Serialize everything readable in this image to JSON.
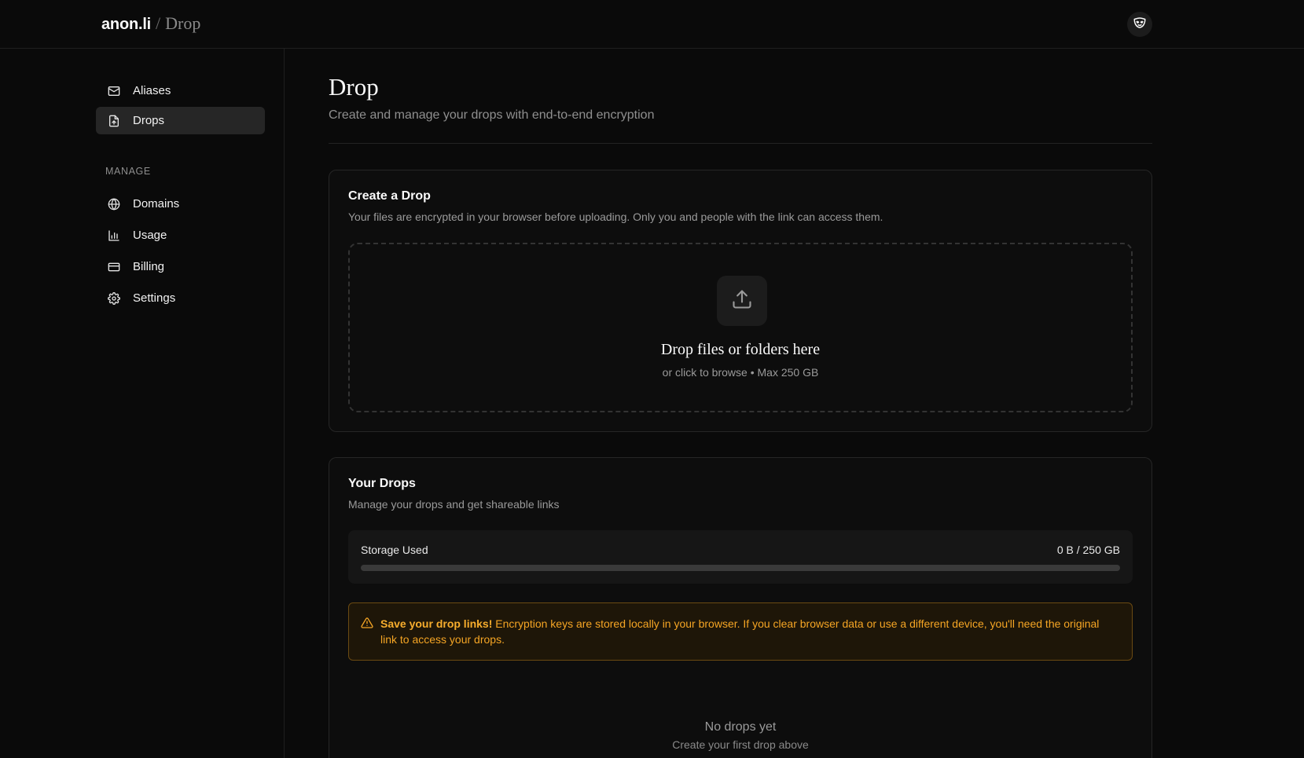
{
  "header": {
    "brand": "anon.li",
    "separator": "/",
    "page": "Drop",
    "avatar_icon": "mask-icon"
  },
  "sidebar": {
    "items": [
      {
        "label": "Aliases",
        "icon": "mail-icon",
        "active": false
      },
      {
        "label": "Drops",
        "icon": "file-upload-icon",
        "active": true
      }
    ],
    "section_label": "MANAGE",
    "manage_items": [
      {
        "label": "Domains",
        "icon": "globe-icon"
      },
      {
        "label": "Usage",
        "icon": "bar-chart-icon"
      },
      {
        "label": "Billing",
        "icon": "credit-card-icon"
      },
      {
        "label": "Settings",
        "icon": "gear-icon"
      }
    ]
  },
  "main": {
    "title": "Drop",
    "subtitle": "Create and manage your drops with end-to-end encryption"
  },
  "create_card": {
    "title": "Create a Drop",
    "description": "Your files are encrypted in your browser before uploading. Only you and people with the link can access them.",
    "dropzone_title": "Drop files or folders here",
    "dropzone_subtitle": "or click to browse • Max 250 GB"
  },
  "drops_card": {
    "title": "Your Drops",
    "description": "Manage your drops and get shareable links",
    "storage_label": "Storage Used",
    "storage_value": "0 B / 250 GB",
    "storage_fraction": 0,
    "warning_bold": "Save your drop links!",
    "warning_text": " Encryption keys are stored locally in your browser. If you clear browser data or use a different device, you'll need the original link to access your drops.",
    "empty_title": "No drops yet",
    "empty_subtitle": "Create your first drop above"
  },
  "colors": {
    "background": "#0a0a0a",
    "active_nav": "#262626",
    "warning": "#f5a524"
  }
}
